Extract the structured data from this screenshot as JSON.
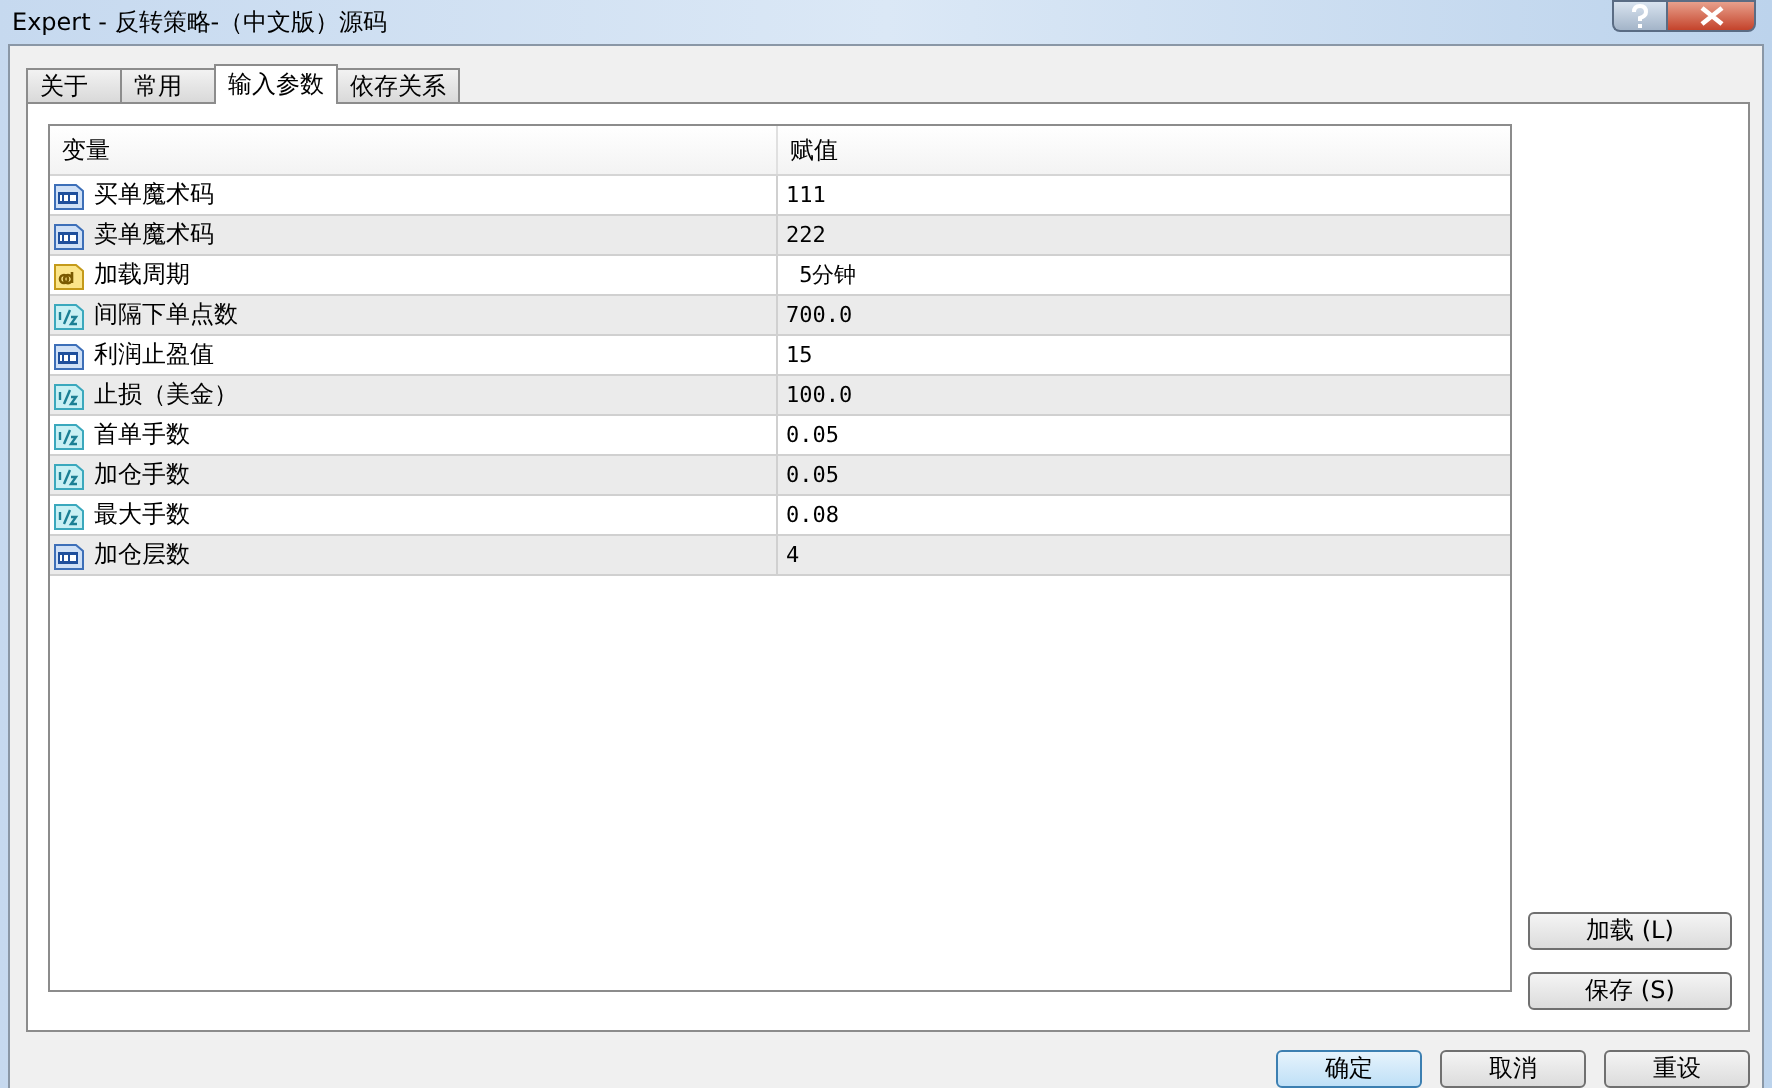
{
  "window": {
    "title": "Expert - 反转策略-（中文版）源码"
  },
  "tabs": [
    {
      "label": "关于",
      "selected": false
    },
    {
      "label": "常用",
      "selected": false
    },
    {
      "label": "输入参数",
      "selected": true
    },
    {
      "label": "依存关系",
      "selected": false
    }
  ],
  "table": {
    "columns": [
      "变量",
      "赋值"
    ],
    "rows": [
      {
        "kind": "int",
        "name": "买单魔术码",
        "value": "111"
      },
      {
        "kind": "int",
        "name": "卖单魔术码",
        "value": "222"
      },
      {
        "kind": "string",
        "name": "加载周期",
        "value": " 5分钟"
      },
      {
        "kind": "double",
        "name": "间隔下单点数",
        "value": "700.0"
      },
      {
        "kind": "int",
        "name": "利润止盈值",
        "value": "15"
      },
      {
        "kind": "double",
        "name": "止损（美金）",
        "value": "100.0"
      },
      {
        "kind": "double",
        "name": "首单手数",
        "value": "0.05"
      },
      {
        "kind": "double",
        "name": "加仓手数",
        "value": "0.05"
      },
      {
        "kind": "double",
        "name": "最大手数",
        "value": "0.08"
      },
      {
        "kind": "int",
        "name": "加仓层数",
        "value": "4"
      }
    ]
  },
  "side_buttons": [
    "加载 (L)",
    "保存 (S)"
  ],
  "buttons": [
    {
      "label": "确定",
      "default": true
    },
    {
      "label": "取消",
      "default": false
    },
    {
      "label": "重设",
      "default": false
    }
  ]
}
